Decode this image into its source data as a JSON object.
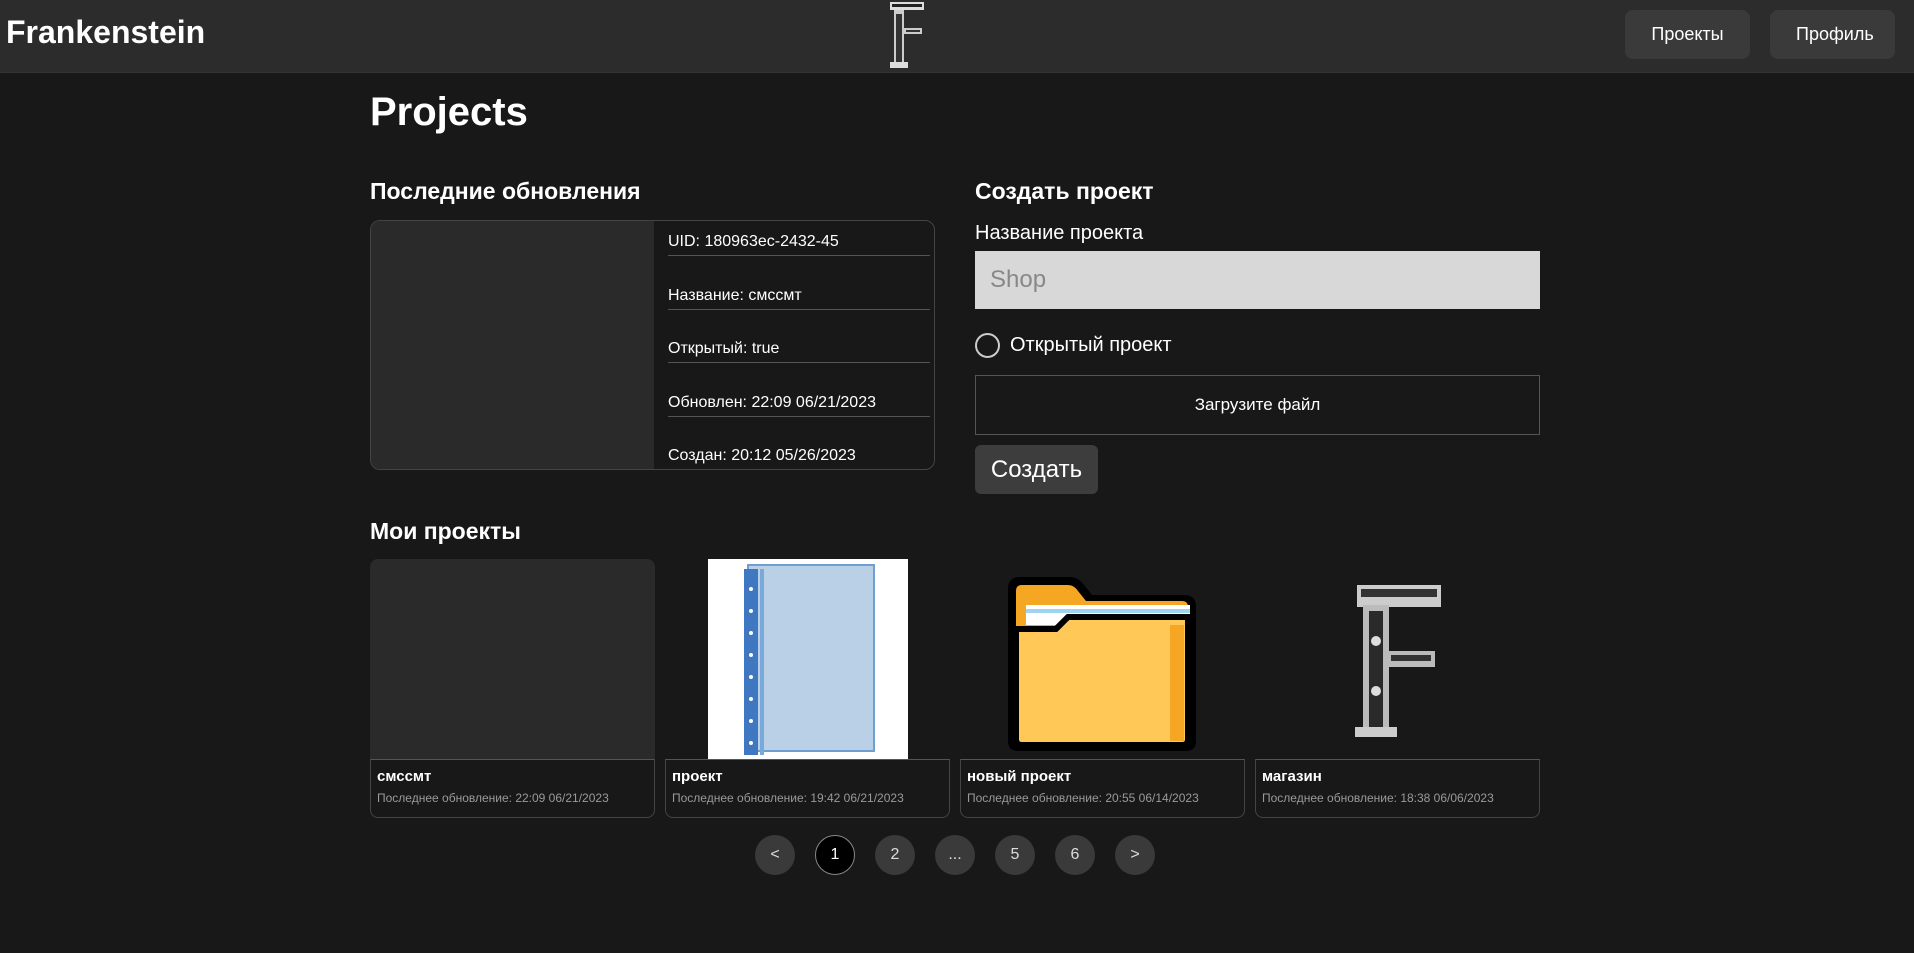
{
  "header": {
    "brand": "Frankenstein",
    "nav": {
      "projects_label": "Проекты",
      "profile_label": "Профиль"
    }
  },
  "page_title": "Projects",
  "recent": {
    "title": "Последние обновления",
    "rows": [
      "UID: 180963ec-2432-45",
      "Название: смссмт",
      "Открытый: true",
      "Обновлен: 22:09 06/21/2023",
      "Создан: 20:12 05/26/2023"
    ]
  },
  "create": {
    "title": "Создать проект",
    "name_label": "Название проекта",
    "name_placeholder": "Shop",
    "open_label": "Открытый проект",
    "upload_label": "Загрузите файл",
    "submit_label": "Создать"
  },
  "my_projects": {
    "title": "Мои проекты",
    "items": [
      {
        "name": "смссмт",
        "updated": "Последнее обновление: 22:09 06/21/2023",
        "thumb": "blank"
      },
      {
        "name": "проект",
        "updated": "Последнее обновление: 19:42 06/21/2023",
        "thumb": "document-folder-icon"
      },
      {
        "name": "новый проект",
        "updated": "Последнее обновление: 20:55 06/14/2023",
        "thumb": "folder-icon"
      },
      {
        "name": "магазин",
        "updated": "Последнее обновление: 18:38 06/06/2023",
        "thumb": "frankenstein-logo"
      }
    ]
  },
  "pagination": {
    "pages": [
      "<",
      "1",
      "2",
      "...",
      "5",
      "6",
      ">"
    ],
    "current": "1"
  },
  "colors": {
    "background": "#181818",
    "header": "#2c2c2c",
    "folder": "#ffc857",
    "input": "#d8d8d8"
  }
}
